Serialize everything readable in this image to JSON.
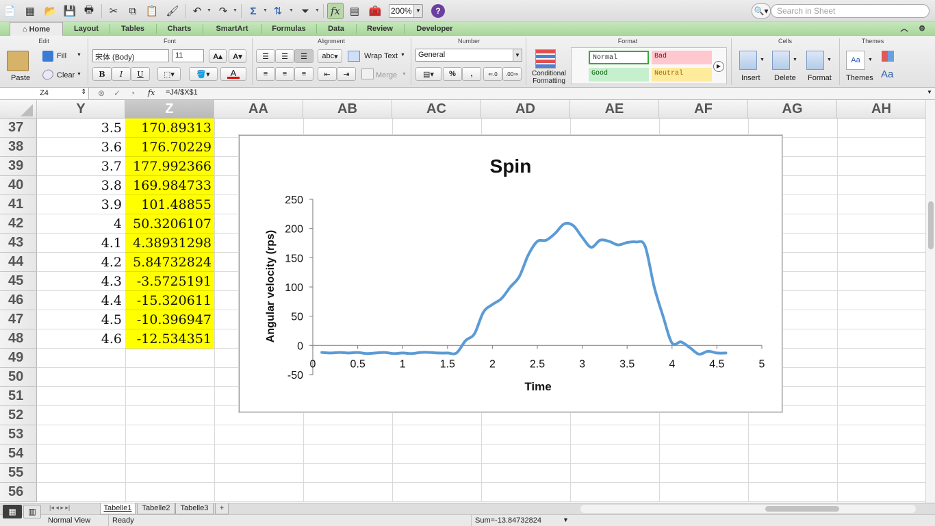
{
  "toolbar": {
    "zoom": "200%",
    "search_placeholder": "Search in Sheet"
  },
  "tabs": [
    "Home",
    "Layout",
    "Tables",
    "Charts",
    "SmartArt",
    "Formulas",
    "Data",
    "Review",
    "Developer"
  ],
  "ribbon": {
    "groups": {
      "edit": "Edit",
      "font": "Font",
      "alignment": "Alignment",
      "number": "Number",
      "format": "Format",
      "cells": "Cells",
      "themes": "Themes"
    },
    "paste": "Paste",
    "fill": "Fill",
    "clear": "Clear",
    "font_name": "宋体 (Body)",
    "font_size": "11",
    "bold": "B",
    "italic": "I",
    "underline": "U",
    "font_color_letter": "A",
    "wrap_text": "Wrap Text",
    "merge": "Merge",
    "abc": "abc",
    "number_format": "General",
    "percent": "%",
    "comma": ",",
    "dec_inc": ".0→.00",
    "dec_dec": ".00→.0",
    "conditional_formatting": "Conditional Formatting",
    "styles": {
      "normal": "Normal",
      "bad": "Bad",
      "good": "Good",
      "neutral": "Neutral"
    },
    "insert": "Insert",
    "delete": "Delete",
    "format_btn": "Format",
    "themes_btn": "Themes",
    "aa": "Aa"
  },
  "formula_bar": {
    "name_box": "Z4",
    "fx": "fx",
    "formula": "=J4/$X$1"
  },
  "columns": [
    "Y",
    "Z",
    "AA",
    "AB",
    "AC",
    "AD",
    "AE",
    "AF",
    "AG",
    "AH"
  ],
  "rows": [
    {
      "n": "37",
      "y": "3.5",
      "z": "170.89313"
    },
    {
      "n": "38",
      "y": "3.6",
      "z": "176.70229"
    },
    {
      "n": "39",
      "y": "3.7",
      "z": "177.992366"
    },
    {
      "n": "40",
      "y": "3.8",
      "z": "169.984733"
    },
    {
      "n": "41",
      "y": "3.9",
      "z": "101.48855"
    },
    {
      "n": "42",
      "y": "4",
      "z": "50.3206107"
    },
    {
      "n": "43",
      "y": "4.1",
      "z": "4.38931298"
    },
    {
      "n": "44",
      "y": "4.2",
      "z": "5.84732824"
    },
    {
      "n": "45",
      "y": "4.3",
      "z": "-3.5725191"
    },
    {
      "n": "46",
      "y": "4.4",
      "z": "-15.320611"
    },
    {
      "n": "47",
      "y": "4.5",
      "z": "-10.396947"
    },
    {
      "n": "48",
      "y": "4.6",
      "z": "-12.534351"
    },
    {
      "n": "49",
      "y": "",
      "z": ""
    },
    {
      "n": "50",
      "y": "",
      "z": ""
    },
    {
      "n": "51",
      "y": "",
      "z": ""
    },
    {
      "n": "52",
      "y": "",
      "z": ""
    },
    {
      "n": "53",
      "y": "",
      "z": ""
    },
    {
      "n": "54",
      "y": "",
      "z": ""
    },
    {
      "n": "55",
      "y": "",
      "z": ""
    },
    {
      "n": "56",
      "y": "",
      "z": ""
    }
  ],
  "sheets": [
    "Tabelle1",
    "Tabelle2",
    "Tabelle3"
  ],
  "status": {
    "view": "Normal View",
    "state": "Ready",
    "sum": "Sum=-13.84732824"
  },
  "colors": {
    "tab_green": "#a9d79b",
    "highlight": "#ffff00",
    "series": "#5b9bd5"
  },
  "chart_data": {
    "type": "line",
    "title": "Spin",
    "xlabel": "Time",
    "ylabel": "Angular velocity (rps)",
    "xlim": [
      0,
      5
    ],
    "ylim": [
      -50,
      250
    ],
    "xticks": [
      "0",
      "0.5",
      "1",
      "1.5",
      "2",
      "2.5",
      "3",
      "3.5",
      "4",
      "4.5",
      "5"
    ],
    "yticks": [
      "-50",
      "0",
      "50",
      "100",
      "150",
      "200",
      "250"
    ],
    "legend": "none",
    "grid": false,
    "series": [
      {
        "x": [
          0.1,
          0.2,
          0.3,
          0.4,
          0.5,
          0.6,
          0.7,
          0.8,
          0.9,
          1.0,
          1.1,
          1.2,
          1.3,
          1.4,
          1.5,
          1.6,
          1.7,
          1.8,
          1.9,
          2.0,
          2.1,
          2.2,
          2.3,
          2.4,
          2.5,
          2.6,
          2.7,
          2.8,
          2.9,
          3.0,
          3.1,
          3.2,
          3.3,
          3.4,
          3.5,
          3.6,
          3.7,
          3.8,
          3.9,
          4.0,
          4.1,
          4.2,
          4.3,
          4.4,
          4.5,
          4.6
        ],
        "y": [
          -12,
          -13,
          -12,
          -13,
          -12,
          -14,
          -13,
          -12,
          -14,
          -13,
          -14,
          -12,
          -12,
          -13,
          -13,
          -13,
          8,
          20,
          57,
          70,
          80,
          100,
          118,
          155,
          178,
          180,
          192,
          208,
          205,
          185,
          168,
          180,
          178,
          172,
          176,
          177,
          170,
          101,
          50,
          4,
          6,
          -4,
          -15,
          -10,
          -13,
          -13
        ]
      }
    ]
  }
}
